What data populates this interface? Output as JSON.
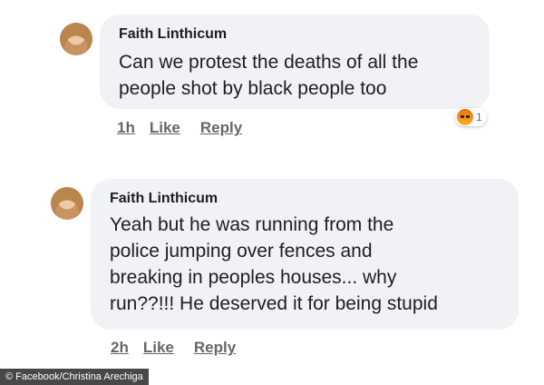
{
  "comments": [
    {
      "author": "Faith Linthicum",
      "lines": [
        "Can we protest the deaths of all the",
        "people shot by black people too"
      ],
      "time": "1h",
      "like_label": "Like",
      "reply_label": "Reply",
      "reaction_icon": "angry-icon",
      "reaction_count": "1"
    },
    {
      "author": "Faith Linthicum",
      "lines": [
        "Yeah but he was running from the",
        "police jumping over fences and",
        "breaking in peoples houses... why",
        "run??!!! He deserved it for being stupid"
      ],
      "time": "2h",
      "like_label": "Like",
      "reply_label": "Reply"
    }
  ],
  "credit": "© Facebook/Christina Arechiga"
}
